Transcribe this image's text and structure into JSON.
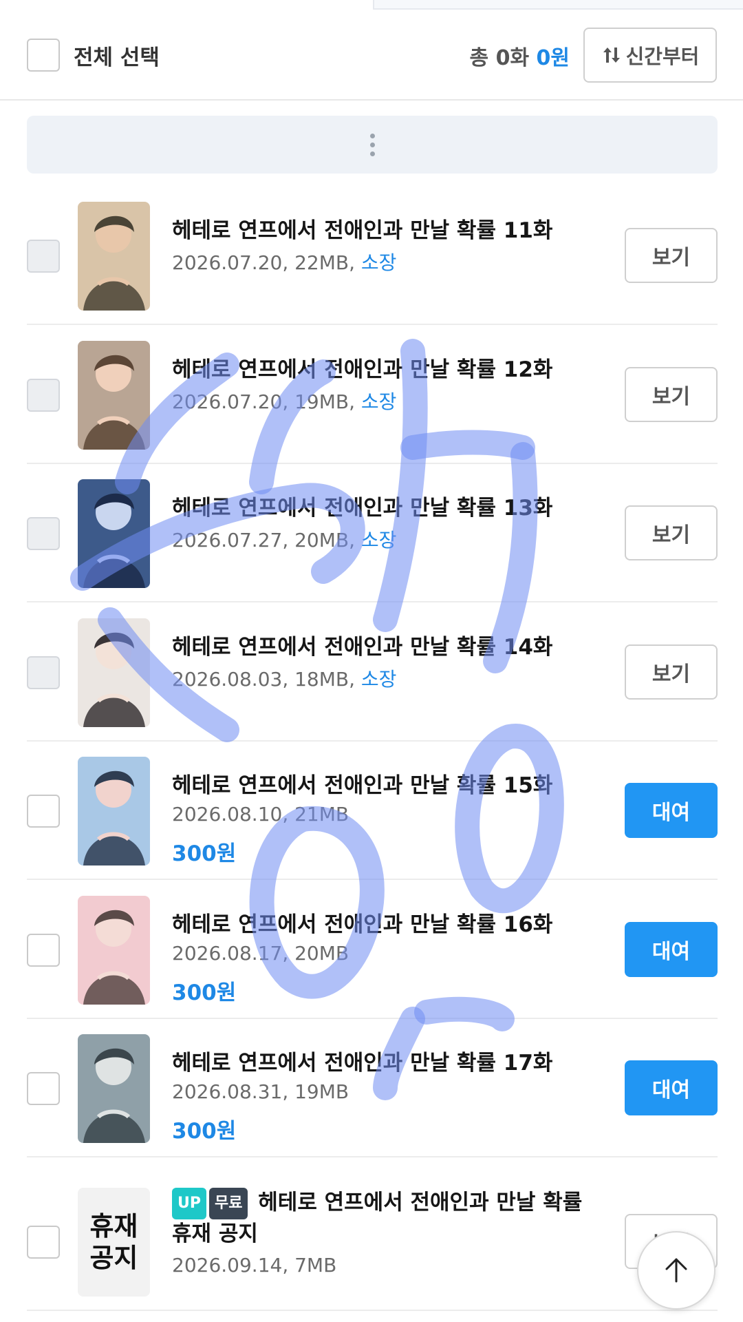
{
  "header": {
    "select_all_label": "전체 선택",
    "total_prefix": "총",
    "total_count": "0화",
    "total_price": "0원",
    "sort_label": "신간부터"
  },
  "episodes": [
    {
      "title": "헤테로 연프에서 전애인과 만날 확률 11화",
      "date_size": "2026.07.20, 22MB,",
      "status": "소장",
      "action": "보기",
      "thumb": {
        "bg": "#d9c4a8",
        "accent": "#4a4436",
        "skin": "#e8c7aa"
      }
    },
    {
      "title": "헤테로 연프에서 전애인과 만날 확률 12화",
      "date_size": "2026.07.20, 19MB,",
      "status": "소장",
      "action": "보기",
      "thumb": {
        "bg": "#b9a594",
        "accent": "#5c4636",
        "skin": "#f0d0bb"
      }
    },
    {
      "title": "헤테로 연프에서 전애인과 만날 확률 13화",
      "date_size": "2026.07.27, 20MB,",
      "status": "소장",
      "action": "보기",
      "thumb": {
        "bg": "#3d5a8a",
        "accent": "#1c2b4a",
        "skin": "#c9d6ef"
      }
    },
    {
      "title": "헤테로 연프에서 전애인과 만날 확률 14화",
      "date_size": "2026.08.03, 18MB,",
      "status": "소장",
      "action": "보기",
      "thumb": {
        "bg": "#ebe6e2",
        "accent": "#3a3436",
        "skin": "#f3e2d8"
      }
    },
    {
      "title": "헤테로 연프에서 전애인과 만날 확률 15화",
      "date_size": "2026.08.10, 21MB",
      "price": "300원",
      "action": "대여",
      "thumb": {
        "bg": "#a9c8e6",
        "accent": "#2f3d52",
        "skin": "#f1d3cd"
      }
    },
    {
      "title": "헤테로 연프에서 전애인과 만날 확률 16화",
      "date_size": "2026.08.17, 20MB",
      "price": "300원",
      "action": "대여",
      "thumb": {
        "bg": "#f2cbd0",
        "accent": "#5a4a48",
        "skin": "#f4dcd6"
      }
    },
    {
      "title": "헤테로 연프에서 전애인과 만날 확률 17화",
      "date_size": "2026.08.31, 19MB",
      "price": "300원",
      "action": "대여",
      "thumb": {
        "bg": "#8fa0a8",
        "accent": "#3b464c",
        "skin": "#dfe3e3"
      }
    }
  ],
  "notice": {
    "badge_up": "UP",
    "badge_free": "무료",
    "title": "헤테로 연프에서 전애인과 만날 확률 휴재 공지",
    "thumb_text_line1": "휴재",
    "thumb_text_line2": "공지",
    "date_size": "2026.09.14, 7MB",
    "action": "보기"
  },
  "colors": {
    "accent_blue": "#1e88e5",
    "rent_button": "#2196f3",
    "overlay_scribble": "#6f8cf3"
  },
  "icons": {
    "sort": "sort-arrows-icon",
    "expand": "vertical-dots-icon",
    "scroll_top": "arrow-up-icon"
  }
}
